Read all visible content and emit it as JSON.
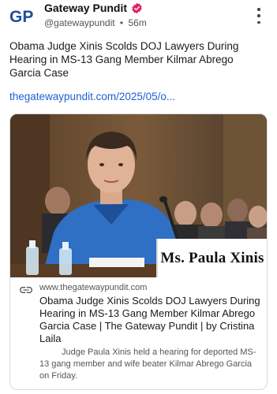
{
  "header": {
    "logo_text": "GP",
    "account_name": "Gateway Pundit",
    "handle": "@gatewaypundit",
    "separator": "•",
    "timestamp": "56m",
    "verified_icon": "verified-badge-icon",
    "more_icon": "more-vertical-icon"
  },
  "post": {
    "text": "Obama Judge Xinis Scolds DOJ Lawyers During Hearing in MS-13 Gang Member Kilmar Abrego Garcia Case",
    "link_text": "thegatewaypundit.com/2025/05/o..."
  },
  "card": {
    "nameplate": "Ms. Paula Xinis",
    "link_icon": "link-icon",
    "domain": "www.thegatewaypundit.com",
    "title": "Obama Judge Xinis Scolds DOJ Lawyers During Hearing in MS-13 Gang Member Kilmar Abrego Garcia Case | The Gateway Pundit | by Cristina Laila",
    "description": "Judge Paula Xinis held a hearing for deported MS-13 gang member and wife beater Kilmar Abrego Garcia on Friday."
  },
  "colors": {
    "link": "#1f5fd6",
    "verified": "#e0245e",
    "logo_blue": "#1d4f9c",
    "logo_red": "#c8102e"
  }
}
